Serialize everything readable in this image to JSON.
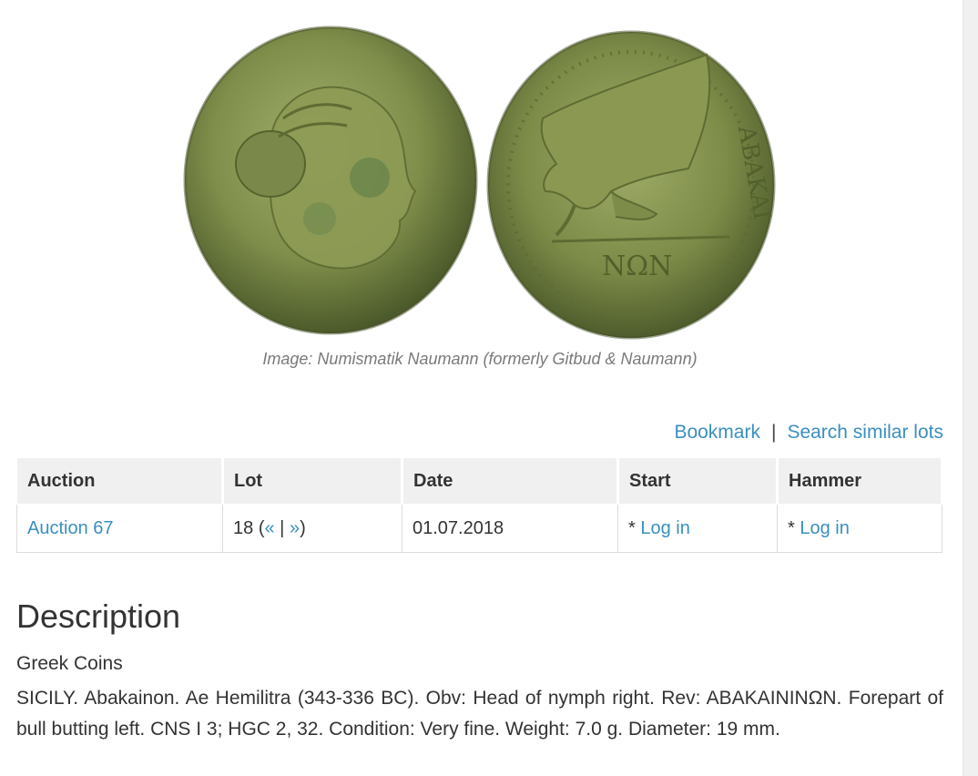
{
  "image": {
    "caption": "Image: Numismatik Naumann (formerly Gitbud & Naumann)",
    "reverse_inscription_top": "ABAKAI",
    "reverse_inscription_bottom": "NΩN"
  },
  "actions": {
    "bookmark": "Bookmark",
    "separator": "|",
    "search_similar": "Search similar lots"
  },
  "table": {
    "headers": [
      "Auction",
      "Lot",
      "Date",
      "Start",
      "Hammer"
    ],
    "row": {
      "auction": "Auction 67",
      "lot_number": "18",
      "lot_open": "(",
      "lot_prev": "«",
      "lot_sep": "|",
      "lot_next": "»",
      "lot_close": ")",
      "date": "01.07.2018",
      "start_prefix": "*",
      "start_link": "Log in",
      "hammer_prefix": "*",
      "hammer_link": "Log in"
    }
  },
  "description": {
    "title": "Description",
    "category": "Greek Coins",
    "text": "SICILY. Abakainon. Ae Hemilitra (343-336 BC). Obv: Head of nymph right. Rev: ABAKAININΩN. Forepart of bull butting left. CNS I 3; HGC 2, 32. Condition: Very fine. Weight: 7.0 g. Diameter: 19 mm."
  },
  "colors": {
    "link": "#3a8fc0",
    "header_bg": "#f0f0f0",
    "coin_light": "#9cab6a",
    "coin_dark": "#4f5f2e"
  }
}
